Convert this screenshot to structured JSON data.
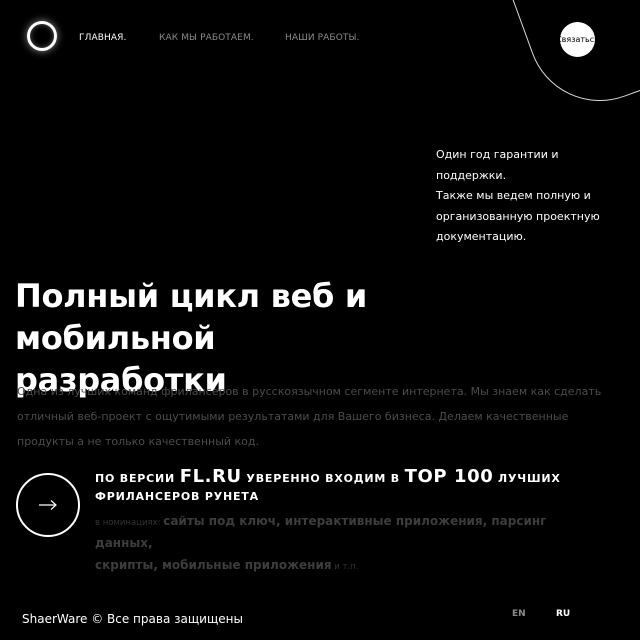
{
  "nav": {
    "items": [
      {
        "label": "ГЛАВНАЯ.",
        "active": true
      },
      {
        "label": "КАК МЫ РАБОТАЕМ.",
        "active": false
      },
      {
        "label": "НАШИ РАБОТЫ.",
        "active": false
      }
    ]
  },
  "contact": {
    "label": "Связаться"
  },
  "guarantee": {
    "lines": [
      "Один год гарантии и поддержки.",
      "Также мы ведем полную и",
      "организованную проектную",
      "документацию."
    ]
  },
  "hero": {
    "title_line1": "Полный цикл веб и",
    "title_line2": "мобильной разработки",
    "description_lines": [
      "Одна из лучших команд фрилансеров в русскоязычном сегменте интернета. Мы знаем как сделать",
      "отличный веб-проект с ощутимыми результатами для Вашего бизнеса. Делаем качественные",
      "продукты а не только качественный код."
    ]
  },
  "achievement": {
    "prefix": "ПО ВЕРСИИ",
    "site": "FL.RU",
    "middle": "УВЕРЕННО ВХОДИМ В",
    "rank": "TOP 100",
    "suffix": "ЛУЧШИХ",
    "line2": "ФРИЛАНСЕРОВ РУНЕТА",
    "nominations_prefix": "в номинациях:",
    "nominations_line1": "сайты под ключ, интерактивные приложения, парсинг данных,",
    "nominations_line2": "скрипты, мобильные приложения",
    "nominations_suffix": "и т.п."
  },
  "icons": {
    "logo": "ring-logo-icon",
    "arrow": "arrow-right-icon"
  },
  "footer": {
    "copyright": "ShaerWare © Все права защищены",
    "lang_en": "EN",
    "lang_ru": "RU"
  },
  "colors": {
    "background": "#000000",
    "text": "#ffffff",
    "muted": "#8a8a8a",
    "description": "#4c4c4c"
  }
}
